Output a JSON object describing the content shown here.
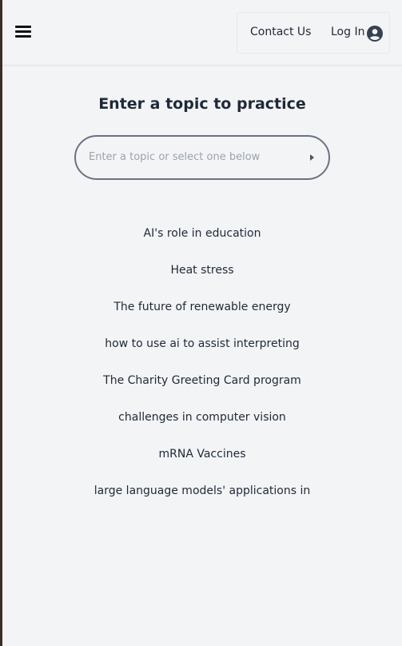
{
  "header": {
    "menu_icon": "hamburger-menu-icon",
    "contact_label": "Contact Us",
    "login_label": "Log In",
    "user_icon": "user-circle-icon"
  },
  "main": {
    "title": "Enter a topic to practice",
    "search": {
      "placeholder": "Enter a topic or select one below",
      "value": "",
      "submit_icon": "caret-right-icon"
    },
    "topics": [
      "AI's role in education",
      "Heat stress",
      "The future of renewable energy",
      "how to use ai to assist interpreting",
      "The Charity Greeting Card program",
      "challenges in computer vision",
      "mRNA Vaccines",
      "large language models' applications in"
    ]
  },
  "colors": {
    "background": "#f3f4f6",
    "text": "#1f2937",
    "input_border": "#6b7280",
    "placeholder": "#9ca3af"
  }
}
